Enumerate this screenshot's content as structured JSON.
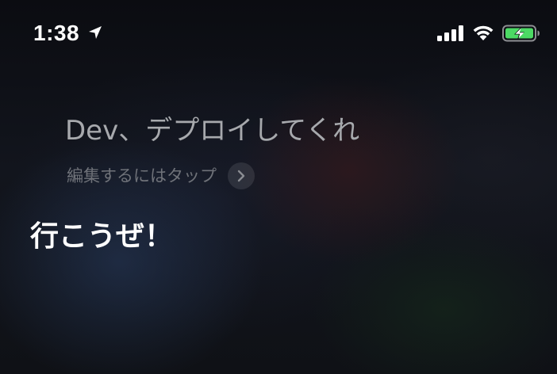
{
  "status_bar": {
    "time": "1:38",
    "icons": [
      "location-icon",
      "signal-icon",
      "wifi-icon",
      "battery-charging-icon"
    ],
    "battery_color": "#4cd964"
  },
  "siri": {
    "request_text": "Dev、デプロイしてくれ",
    "edit_hint": "編集するにはタップ",
    "edit_icon": "chevron-right-icon",
    "response_text": "行こうぜ！"
  }
}
